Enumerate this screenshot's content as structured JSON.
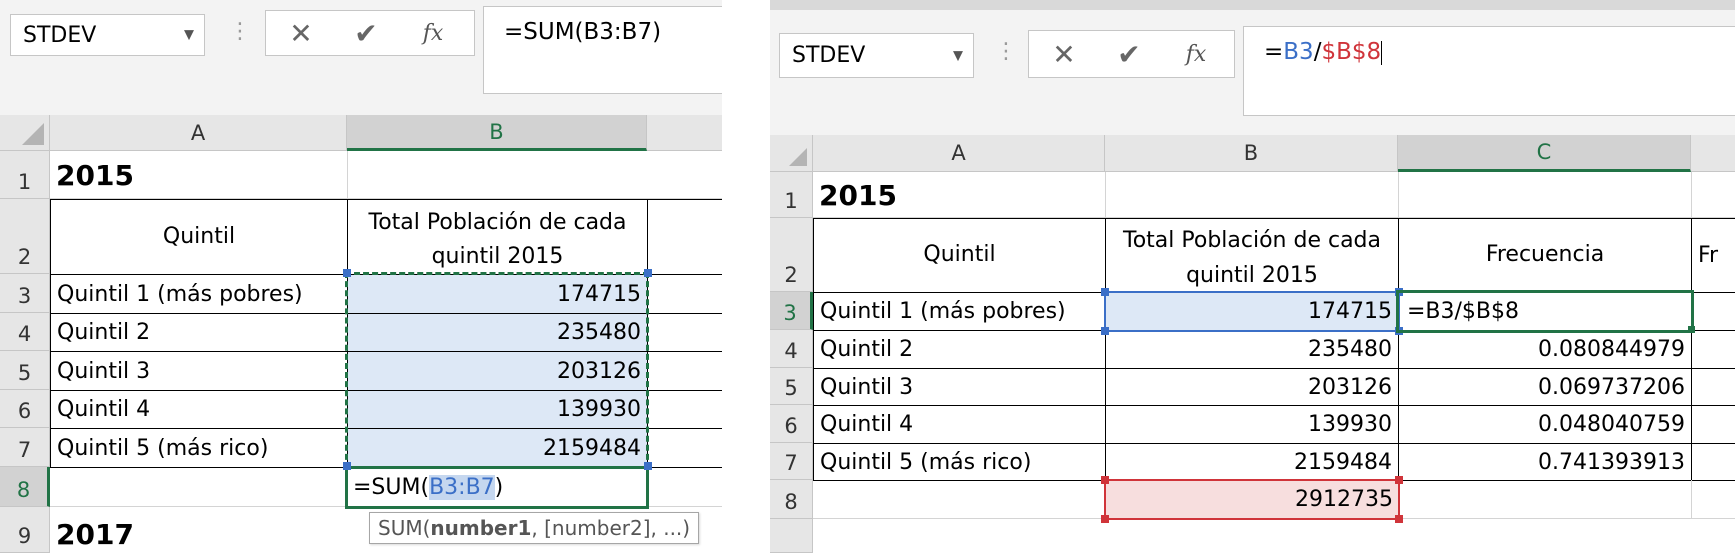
{
  "left_panel": {
    "name_box": "STDEV",
    "cancel_icon": "close-icon",
    "enter_icon": "check-icon",
    "fx_label": "fx",
    "formula": "=SUM(B3:B7)",
    "columns": [
      "A",
      "B"
    ],
    "rows": [
      "1",
      "2",
      "3",
      "4",
      "5",
      "6",
      "7",
      "8",
      "9"
    ],
    "cells": {
      "a1": "2015",
      "a2": "Quintil",
      "b2": "Total Población de cada quintil 2015",
      "a3": "Quintil 1 (más pobres)",
      "b3": "174715",
      "a4": "Quintil 2",
      "b4": "235480",
      "a5": "Quintil 3",
      "b5": "203126",
      "a6": "Quintil 4",
      "b6": "139930",
      "a7": "Quintil 5 (más rico)",
      "b7": "2159484",
      "b8_prefix": "=SUM(",
      "b8_ref": "B3:B7",
      "b8_suffix": ")",
      "a9": "2017"
    },
    "tooltip": {
      "fn": "SUM(",
      "bold_arg": "number1",
      "rest": ", [number2], ...)"
    }
  },
  "right_panel": {
    "name_box": "STDEV",
    "cancel_icon": "close-icon",
    "enter_icon": "check-icon",
    "fx_label": "fx",
    "formula": {
      "eq": "=",
      "ref1": "B3",
      "slash": "/",
      "ref2": "$B$8"
    },
    "columns": [
      "A",
      "B",
      "C"
    ],
    "rows": [
      "1",
      "2",
      "3",
      "4",
      "5",
      "6",
      "7",
      "8"
    ],
    "cells": {
      "a1": "2015",
      "a2": "Quintil",
      "b2": "Total Población de cada quintil 2015",
      "c2": "Frecuencia",
      "d2_partial": "Fr",
      "a3": "Quintil 1 (más pobres)",
      "b3": "174715",
      "c3": "=B3/$B$8",
      "a4": "Quintil 2",
      "b4": "235480",
      "c4": "0.080844979",
      "a5": "Quintil 3",
      "b5": "203126",
      "c5": "0.069737206",
      "a6": "Quintil 4",
      "b6": "139930",
      "c6": "0.048040759",
      "a7": "Quintil 5 (más rico)",
      "b7": "2159484",
      "c7": "0.741393913",
      "b8": "2912735"
    },
    "colors": {
      "ref_blue": "#3b6fc7",
      "ref_red": "#d0343a",
      "excel_green": "#217346"
    }
  }
}
